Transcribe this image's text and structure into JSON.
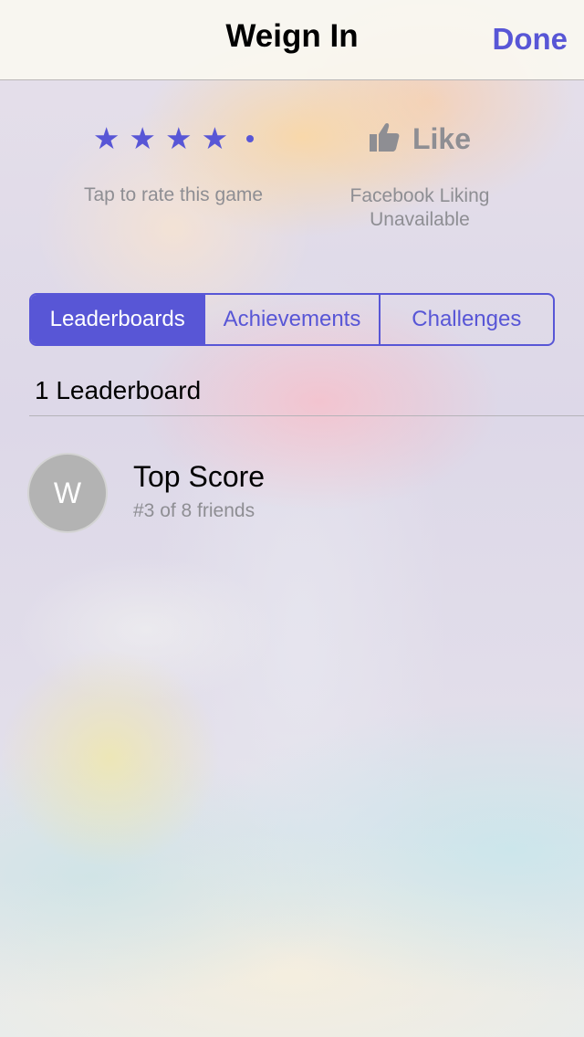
{
  "header": {
    "title": "Weign In",
    "done_label": "Done"
  },
  "rating": {
    "stars": [
      "★",
      "★",
      "★",
      "★"
    ],
    "label": "Tap to rate this game"
  },
  "like": {
    "icon": "thumbs-up-icon",
    "label": "Like",
    "status_line1": "Facebook Liking",
    "status_line2": "Unavailable"
  },
  "tabs": [
    {
      "label": "Leaderboards",
      "active": true
    },
    {
      "label": "Achievements",
      "active": false
    },
    {
      "label": "Challenges",
      "active": false
    }
  ],
  "section": {
    "title": "1 Leaderboard"
  },
  "leaderboards": [
    {
      "avatar_letter": "W",
      "title": "Top Score",
      "subtitle": "#3 of 8 friends"
    }
  ],
  "colors": {
    "accent": "#5856d6",
    "secondary_text": "#8e8e93"
  }
}
